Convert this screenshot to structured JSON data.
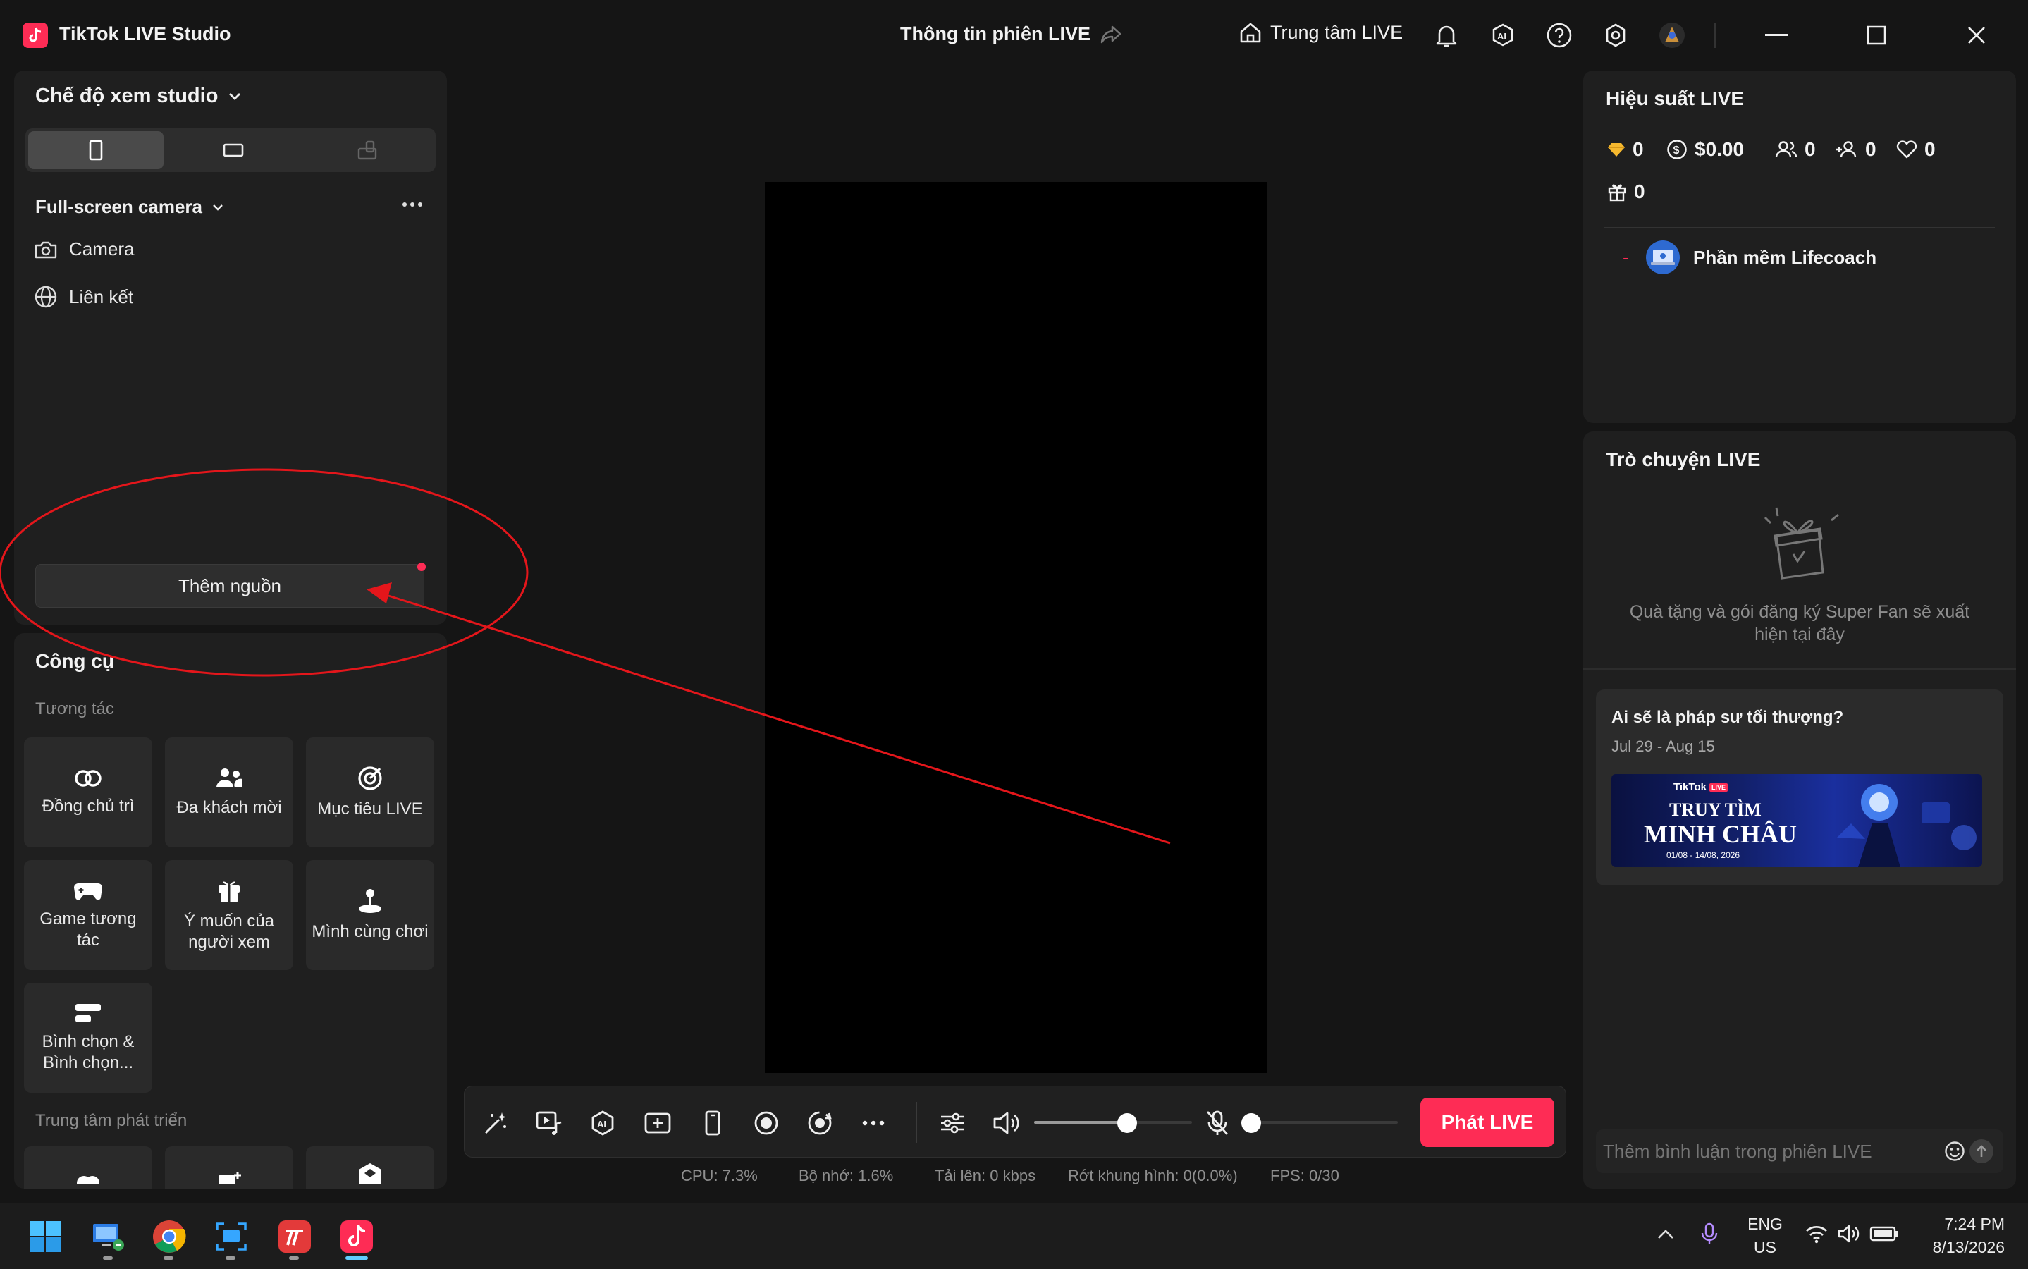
{
  "window": {
    "app_title": "TikTok LIVE Studio",
    "session_title": "Thông tin phiên LIVE",
    "live_center_label": "Trung tâm LIVE"
  },
  "studio": {
    "view_mode_label": "Chế độ xem studio",
    "scene_name": "Full-screen camera",
    "sources": [
      {
        "label": "Camera",
        "icon": "camera-icon"
      },
      {
        "label": "Liên kết",
        "icon": "globe-icon"
      }
    ],
    "add_source_label": "Thêm nguồn"
  },
  "tools": {
    "title": "Công cụ",
    "interact_section": "Tương tác",
    "items": [
      {
        "label": "Đồng chủ trì",
        "icon": "co-host-icon"
      },
      {
        "label": "Đa khách mời",
        "icon": "multi-guest-icon"
      },
      {
        "label": "Mục tiêu LIVE",
        "icon": "target-icon"
      },
      {
        "label": "Game tương tác",
        "icon": "gamepad-icon"
      },
      {
        "label": "Ý muốn của người xem",
        "icon": "gift-wish-icon"
      },
      {
        "label": "Mình cùng chơi",
        "icon": "joystick-icon"
      },
      {
        "label": "Bình chọn & Bình chọn...",
        "icon": "poll-icon"
      }
    ],
    "growth_section": "Trung tâm phát triển"
  },
  "performance": {
    "title": "Hiệu suất LIVE",
    "diamonds": "0",
    "earnings": "$0.00",
    "viewers": "0",
    "new_followers": "0",
    "likes": "0",
    "gifts": "0",
    "top_viewer_rank": "-",
    "top_viewer_name": "Phần mềm Lifecoach"
  },
  "chat": {
    "title": "Trò chuyện LIVE",
    "empty_text": "Quà tặng và gói đăng ký Super Fan sẽ xuất hiện tại đây",
    "promo_title": "Ai sẽ là pháp sư tối thượng?",
    "promo_dates": "Jul 29 - Aug 15",
    "banner_brand": "TikTok",
    "banner_live_tag": "LIVE",
    "banner_line1": "TRUY TÌM",
    "banner_line2": "MINH CHÂU",
    "banner_dates": "01/08 - 14/08, 2026",
    "comment_placeholder": "Thêm bình luận trong phiên LIVE"
  },
  "controls": {
    "go_live_label": "Phát LIVE",
    "speaker_volume": 0.6,
    "mic_volume": 0.0
  },
  "status": {
    "cpu": "CPU:  7.3%",
    "memory": "Bộ nhớ:  1.6%",
    "upload": "Tải lên:  0 kbps",
    "dropped": "Rớt khung hình:  0(0.0%)",
    "fps": "FPS:  0/30"
  },
  "taskbar": {
    "lang_top": "ENG",
    "lang_bottom": "US",
    "time": "7:24 PM",
    "date": "8/13/2026"
  },
  "colors": {
    "accent": "#fe2c55",
    "annotation": "#e4161b",
    "panel": "#1f1f1f",
    "background": "#151515"
  }
}
